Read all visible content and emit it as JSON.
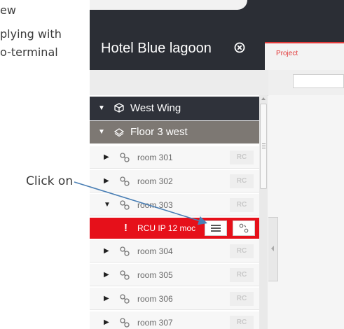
{
  "doc": {
    "line1": "ew",
    "line2": "plying with",
    "line3": "o-terminal",
    "callout": "Click on"
  },
  "app": {
    "title": "Hotel Blue lagoon",
    "tab_project": "Project"
  },
  "tree": {
    "wing": "West Wing",
    "floor": "Floor 3 west",
    "rc_label": "RC",
    "rooms_before": [
      "room 301",
      "room 302",
      "room 303"
    ],
    "alert_row": {
      "mark": "!",
      "label": "RCU IP 12 moc"
    },
    "rooms_after": [
      "room 304",
      "room 305",
      "room 306",
      "room 307"
    ]
  },
  "colors": {
    "header_bg": "#2b2e35",
    "floor_bg": "#7d7873",
    "alert_bg": "#e6101a",
    "pointer": "#4a7fb5"
  }
}
